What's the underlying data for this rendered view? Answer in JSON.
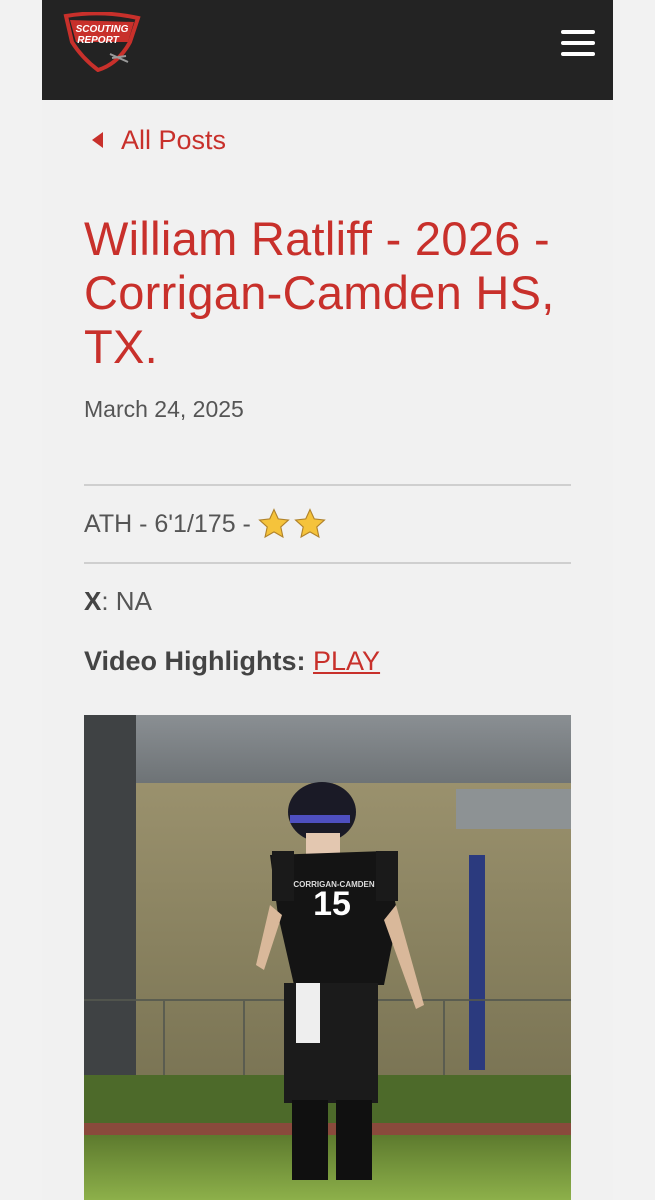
{
  "header": {
    "logo_text_line1": "SCOUTING",
    "logo_text_line2": "REPORT"
  },
  "nav": {
    "back_label": "All Posts"
  },
  "post": {
    "title": "William Ratliff - 2026 - Corrigan-Camden HS, TX.",
    "date": "March 24, 2025",
    "meta": "ATH - 6'1/175 -",
    "star_count": 2,
    "x_label": "X",
    "x_value": ": NA",
    "video_label": "Video Highlights:",
    "video_link": "PLAY",
    "jersey_number": "15",
    "jersey_team": "CORRIGAN-CAMDEN"
  },
  "colors": {
    "accent": "#c8302b",
    "header_bg": "#232323",
    "page_bg": "#f1f1f1"
  },
  "icons": [
    "shield-logo-icon",
    "menu-icon",
    "caret-left-icon",
    "star-icon"
  ]
}
